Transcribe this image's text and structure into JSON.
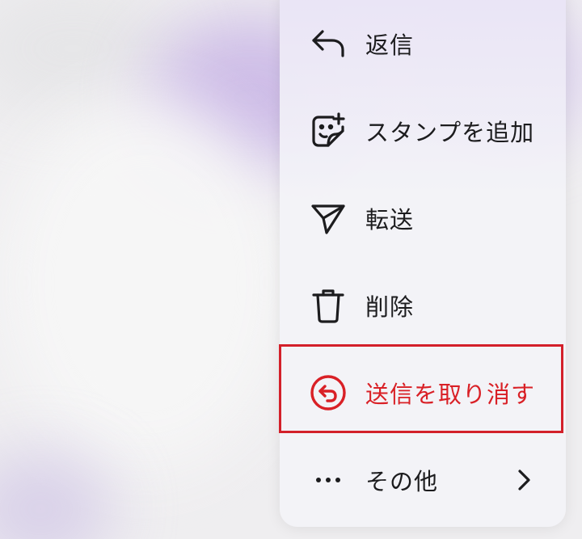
{
  "menu": {
    "items": [
      {
        "label": "返信",
        "icon": "reply-arrow-icon"
      },
      {
        "label": "スタンプを追加",
        "icon": "add-sticker-icon"
      },
      {
        "label": "転送",
        "icon": "forward-send-icon"
      },
      {
        "label": "削除",
        "icon": "trash-icon"
      },
      {
        "label": "送信を取り消す",
        "icon": "unsend-icon",
        "color": "#d92026",
        "highlighted": true
      },
      {
        "label": "その他",
        "icon": "more-dots-icon",
        "trailing_icon": "chevron-right-icon"
      }
    ]
  },
  "colors": {
    "danger": "#d92026",
    "highlight_border": "#d3202a",
    "text": "#1c1c1e",
    "menu_background": "#f3f2f7"
  }
}
